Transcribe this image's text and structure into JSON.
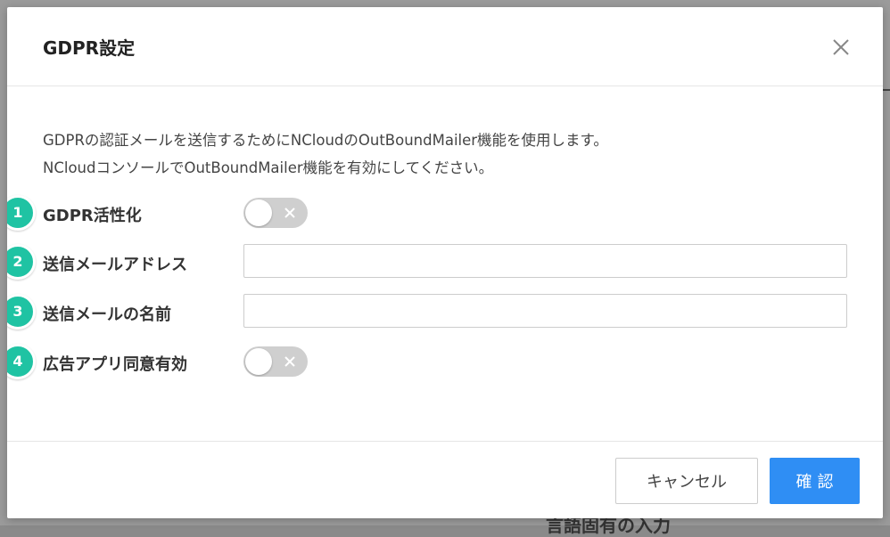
{
  "dialog": {
    "title": "GDPR設定",
    "description_line1": "GDPRの認証メールを送信するためにNCloudのOutBoundMailer機能を使用します。",
    "description_line2": "NCloudコンソールでOutBoundMailer機能を有効にしてください。"
  },
  "fields": [
    {
      "badge": "1",
      "label": "GDPR活性化",
      "type": "toggle",
      "enabled": false
    },
    {
      "badge": "2",
      "label": "送信メールアドレス",
      "type": "text",
      "value": ""
    },
    {
      "badge": "3",
      "label": "送信メールの名前",
      "type": "text",
      "value": ""
    },
    {
      "badge": "4",
      "label": "広告アプリ同意有効",
      "type": "toggle",
      "enabled": false
    }
  ],
  "footer": {
    "cancel_label": "キャンセル",
    "confirm_label": "確認"
  },
  "background": {
    "partial_text": "言語固有の入力"
  },
  "colors": {
    "accent": "#2f8ef4",
    "badge": "#1fc3a3",
    "toggle_off": "#cfcfcf"
  },
  "icons": {
    "close": "close-icon",
    "toggle_off_mark": "x-icon"
  }
}
